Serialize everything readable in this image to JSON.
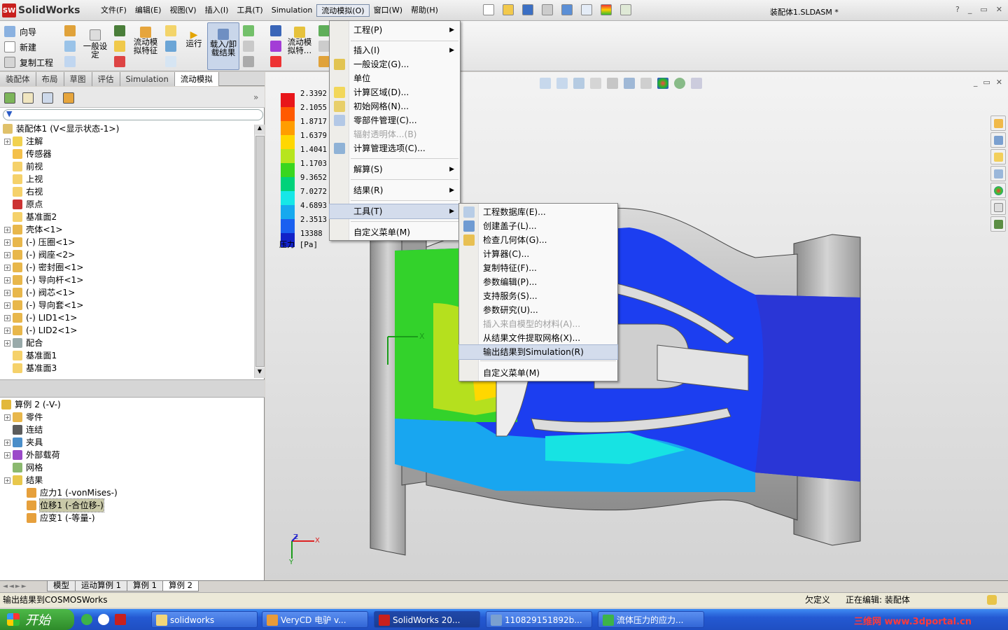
{
  "app": {
    "logo_text": "SolidWorks",
    "doc_title": "装配体1.SLDASM *"
  },
  "menubar": {
    "items": [
      "文件(F)",
      "编辑(E)",
      "视图(V)",
      "插入(I)",
      "工具(T)",
      "Simulation",
      "流动模拟(O)",
      "窗口(W)",
      "帮助(H)"
    ],
    "active_index": 6
  },
  "commands": {
    "left": [
      "向导",
      "新建",
      "复制工程"
    ],
    "general_settings": "一般设定",
    "flow_feature": "流动模拟特征",
    "run": "运行",
    "load_results": "载入/卸载结果",
    "flow_sim_more": "流动模拟特…"
  },
  "cm_tabs": [
    "装配体",
    "布局",
    "草图",
    "评估",
    "Simulation",
    "流动模拟"
  ],
  "cm_tabs_active": 5,
  "tree": {
    "root": "装配体1 (V<显示状态-1>)",
    "items": [
      {
        "label": "注解",
        "expand": true
      },
      {
        "label": "传感器",
        "expand": false
      },
      {
        "label": "前视",
        "expand": false
      },
      {
        "label": "上视",
        "expand": false
      },
      {
        "label": "右视",
        "expand": false
      },
      {
        "label": "原点",
        "expand": false
      },
      {
        "label": "基准面2",
        "expand": false
      },
      {
        "label": "壳体<1>",
        "expand": true
      },
      {
        "label": "(-) 压圈<1>",
        "expand": true
      },
      {
        "label": "(-) 阀座<2>",
        "expand": true
      },
      {
        "label": "(-) 密封圈<1>",
        "expand": true
      },
      {
        "label": "(-) 导向杆<1>",
        "expand": true
      },
      {
        "label": "(-) 阀芯<1>",
        "expand": true
      },
      {
        "label": "(-) 导向套<1>",
        "expand": true
      },
      {
        "label": "(-) LID1<1>",
        "expand": true
      },
      {
        "label": "(-) LID2<1>",
        "expand": true
      },
      {
        "label": "配合",
        "expand": true
      },
      {
        "label": "基准面1",
        "expand": false
      },
      {
        "label": "基准面3",
        "expand": false
      }
    ]
  },
  "sim_tree": {
    "root": "算例 2 (-V-)",
    "items": [
      {
        "label": "零件",
        "expand": true,
        "indent": 1
      },
      {
        "label": "连结",
        "expand": false,
        "indent": 1
      },
      {
        "label": "夹具",
        "expand": true,
        "indent": 1
      },
      {
        "label": "外部载荷",
        "expand": true,
        "indent": 1
      },
      {
        "label": "网格",
        "expand": false,
        "indent": 1
      },
      {
        "label": "结果",
        "expand": true,
        "indent": 1
      },
      {
        "label": "应力1 (-vonMises-)",
        "expand": false,
        "indent": 2
      },
      {
        "label": "位移1 (-合位移-)",
        "expand": false,
        "indent": 2,
        "selected": true
      },
      {
        "label": "应变1 (-等量-)",
        "expand": false,
        "indent": 2
      }
    ]
  },
  "bottom_tabs": [
    "模型",
    "运动算例 1",
    "算例 1",
    "算例 2"
  ],
  "bottom_tabs_active": 3,
  "status": {
    "left": "输出结果到COSMOSWorks",
    "mid": "欠定义",
    "right": "正在编辑: 装配体"
  },
  "legend": {
    "labels": [
      "2.3392",
      "2.1055",
      "1.8717",
      "1.6379",
      "1.4041",
      "1.1703",
      "9.3652",
      "7.0272",
      "4.6893",
      "2.3513",
      "13388"
    ],
    "caption": "压力 [Pa]",
    "colors": [
      "#e8161a",
      "#ff5a00",
      "#ff9d00",
      "#ffd700",
      "#b7e51e",
      "#39d61f",
      "#00d27a",
      "#16e7e7",
      "#16a9ef",
      "#1a60f0",
      "#1222c8"
    ]
  },
  "flow_menu": {
    "items": [
      {
        "label": "工程(P)",
        "sub": true
      },
      {
        "label": "插入(I)",
        "sub": true
      },
      {
        "label": "一般设定(G)..."
      },
      {
        "label": "单位"
      },
      {
        "label": "计算区域(D)..."
      },
      {
        "label": "初始网格(N)..."
      },
      {
        "label": "零部件管理(C)..."
      },
      {
        "label": "辐射透明体...(B)",
        "disabled": true
      },
      {
        "label": "计算管理选项(C)..."
      },
      {
        "label": "解算(S)",
        "sub": true
      },
      {
        "label": "结果(R)",
        "sub": true
      },
      {
        "label": "工具(T)",
        "sub": true,
        "highlight": true
      },
      {
        "label": "自定义菜单(M)"
      }
    ]
  },
  "tools_menu": {
    "items": [
      {
        "label": "工程数据库(E)..."
      },
      {
        "label": "创建盖子(L)..."
      },
      {
        "label": "检查几何体(G)..."
      },
      {
        "label": "计算器(C)..."
      },
      {
        "label": "复制特征(F)..."
      },
      {
        "label": "参数编辑(P)..."
      },
      {
        "label": "支持服务(S)..."
      },
      {
        "label": "参数研究(U)..."
      },
      {
        "label": "插入来自模型的材料(A)...",
        "disabled": true
      },
      {
        "label": "从结果文件提取网格(X)..."
      },
      {
        "label": "输出结果到Simulation(R)",
        "highlight": true
      },
      {
        "label": "自定义菜单(M)"
      }
    ]
  },
  "taskbar": {
    "start": "开始",
    "tasks": [
      "solidworks",
      "VeryCD 电驴 v...",
      "SolidWorks 20...",
      "110829151892b...",
      "流体压力的应力..."
    ],
    "active_index": 2,
    "watermark": "三维网 www.3dportal.cn"
  },
  "axis_labels": {
    "x": "X",
    "y": "Y",
    "z": "Z"
  }
}
